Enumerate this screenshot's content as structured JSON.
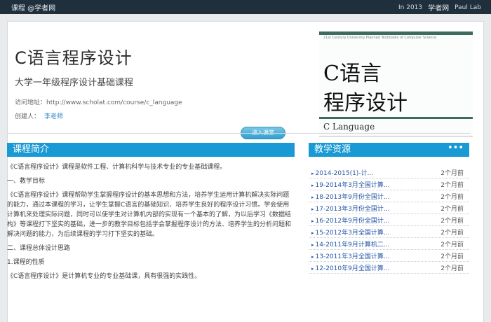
{
  "topbar": {
    "brand": "课程 @学者网",
    "site_link": "学者网",
    "site_prefix": "In 2013",
    "login": "Paul Lab"
  },
  "course": {
    "title": "C语言程序设计",
    "subtitle": "大学一年级程序设计基础课程",
    "url_line": "访问地址：http://www.scholat.com/course/c_language",
    "author_label": "创建人：",
    "author_name": "李老师",
    "enter_label": "进入课堂"
  },
  "cover": {
    "tag": "21st Century University Planned Textbooks of Computer Science",
    "line1": "C语言",
    "line2": "程序设计",
    "english": "C Language"
  },
  "intro": {
    "heading": "课程简介",
    "paragraphs": [
      "《C语言程序设计》课程是软件工程、计算机科学与技术专业的专业基础课程。",
      "一、教学目标",
      "《C语言程序设计》课程帮助学生掌握程序设计的基本思想和方法，培养学生运用计算机解决实际问题的能力，通过本课程的学习，让学生掌握C语言的基础知识、培养学生良好的程序设计习惯。学会使用计算机来处理实际问题，同时可以使学生对计算机内部的实现有一个基本的了解，为以后学习《数据结构》等课程打下坚实的基础，进一步的教学目标包括学会掌握程序设计的方法、培养学生的分析问题和解决问题的能力，为后续课程的学习打下坚实的基础。",
      "二、课程总体设计思路",
      "1.课程的性质",
      "《C语言程序设计》是计算机专业的专业基础课，具有很强的实践性。"
    ]
  },
  "resources": {
    "heading": "教学资源",
    "more": "•••",
    "items": [
      {
        "title": "2014-2015(1)-计...",
        "time": "2个月前"
      },
      {
        "title": "19-2014年3月全国计算...",
        "time": "2个月前"
      },
      {
        "title": "18-2013年9月份全国计...",
        "time": "2个月前"
      },
      {
        "title": "17-2013年3月份全国计...",
        "time": "2个月前"
      },
      {
        "title": "16-2012年9月份全国计...",
        "time": "2个月前"
      },
      {
        "title": "15-2012年3月全国计算...",
        "time": "2个月前"
      },
      {
        "title": "14-2011年9月计算机二...",
        "time": "2个月前"
      },
      {
        "title": "13-2011年3月全国计算...",
        "time": "2个月前"
      },
      {
        "title": "12-2010年9月全国计算...",
        "time": "2个月前"
      }
    ]
  },
  "colors": {
    "topbar": "#1f2f3c",
    "section_header": "#1a9ad4",
    "link": "#2456a8",
    "cover_green": "#3e6a60"
  }
}
